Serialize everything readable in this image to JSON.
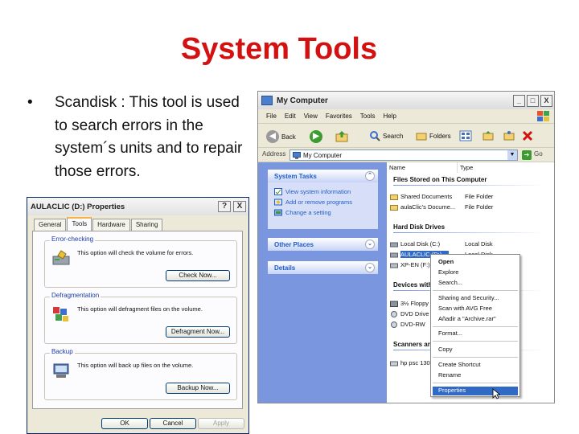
{
  "slide": {
    "title": "System Tools",
    "bullet_symbol": "•",
    "bullet_text": "Scandisk : This tool is used to search errors in the system´s units and to repair those errors."
  },
  "properties_dialog": {
    "title": "AULACLIC (D:) Properties",
    "help_button": "?",
    "close_button": "X",
    "tabs": [
      "General",
      "Tools",
      "Hardware",
      "Sharing"
    ],
    "active_tab": "Tools",
    "groups": [
      {
        "label": "Error-checking",
        "text": "This option will check the volume for errors.",
        "button": "Check Now...",
        "icon": "disk-check-icon"
      },
      {
        "label": "Defragmentation",
        "text": "This option will defragment files on the volume.",
        "button": "Defragment Now...",
        "icon": "defrag-icon"
      },
      {
        "label": "Backup",
        "text": "This option will back up files on the volume.",
        "button": "Backup Now...",
        "icon": "backup-icon"
      }
    ],
    "footer": {
      "ok": "OK",
      "cancel": "Cancel",
      "apply": "Apply"
    }
  },
  "my_computer": {
    "title": "My Computer",
    "window_buttons": [
      "_",
      "□",
      "X"
    ],
    "menu": [
      "File",
      "Edit",
      "View",
      "Favorites",
      "Tools",
      "Help"
    ],
    "toolbar": {
      "back": "Back",
      "search": "Search",
      "folders": "Folders"
    },
    "address": {
      "label": "Address",
      "value": "My Computer",
      "go": "Go"
    },
    "left_pane": {
      "system_tasks": {
        "header": "System Tasks",
        "items": [
          "View system information",
          "Add or remove programs",
          "Change a setting"
        ]
      },
      "other_places": {
        "header": "Other Places"
      },
      "details": {
        "header": "Details"
      }
    },
    "columns": {
      "name": "Name",
      "type": "Type"
    },
    "sections": [
      {
        "header": "Files Stored on This Computer",
        "rows": [
          {
            "name": "Shared Documents",
            "type": "File Folder"
          },
          {
            "name": "aulaClic's Docume...",
            "type": "File Folder"
          }
        ]
      },
      {
        "header": "Hard Disk Drives",
        "rows": [
          {
            "name": "Local Disk (C:)",
            "type": "Local Disk"
          },
          {
            "name": "AULACLIC (D:)",
            "type": "Local Disk"
          },
          {
            "name": "XP-EN (F:)",
            "type": ""
          }
        ]
      },
      {
        "header": "Devices with Removable Storage",
        "rows": [
          {
            "name": "3½ Floppy (A:)",
            "type": ""
          },
          {
            "name": "DVD Drive",
            "type": ""
          },
          {
            "name": "DVD-RW",
            "type": ""
          }
        ]
      },
      {
        "header": "Scanners and Cameras",
        "rows": [
          {
            "name": "hp psc 1300",
            "type": ""
          }
        ]
      }
    ],
    "context_menu": {
      "items": [
        "Open",
        "Explore",
        "Search...",
        "Sharing and Security...",
        "Scan with AVG Free",
        "Añadir a \"Archive.rar\"",
        "Format...",
        "Copy",
        "Create Shortcut",
        "Rename",
        "Properties"
      ],
      "highlighted": "Properties"
    }
  },
  "colors": {
    "title_red": "#d41111",
    "xp_blue": "#215dc6",
    "selection_blue": "#316ac5",
    "taskpane_blue": "#7a96df",
    "dialog_face": "#ece9d8"
  }
}
